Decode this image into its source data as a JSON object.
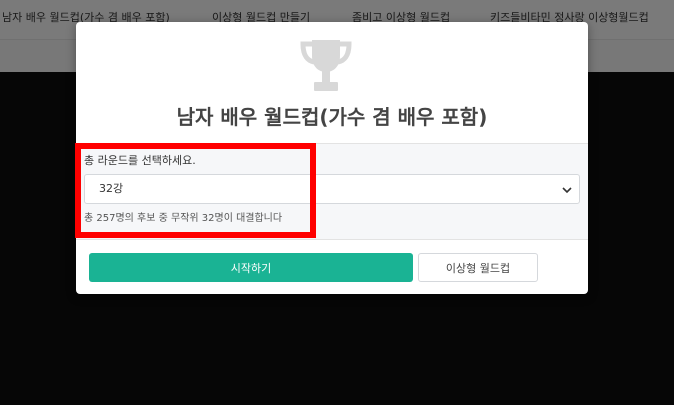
{
  "nav": {
    "items": [
      "남자 배우 월드컵(가수 겸 배우 포함)",
      "이상형 월드컵 만들기",
      "좀비고 이상형 월드컵",
      "키즈들비타민 정사랑 이상형월드컵"
    ]
  },
  "modal": {
    "icon": "trophy-icon",
    "title": "남자 배우 월드컵(가수 겸 배우 포함)",
    "round_label": "총 라운드를 선택하세요.",
    "round_selected": "32강",
    "help_text": "총 257명의 후보 중 무작위 32명이 대결합니다",
    "start_label": "시작하기",
    "worldcup_label": "이상형 월드컵"
  },
  "colors": {
    "primary": "#1ab394",
    "highlight": "#ff0000",
    "overlay": "#0d0d0d",
    "trophy": "#d8d8d8"
  }
}
